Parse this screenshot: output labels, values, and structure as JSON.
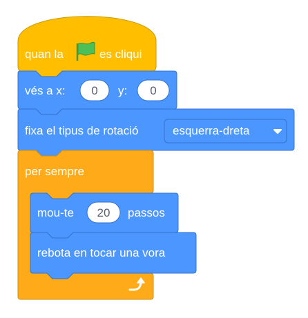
{
  "colors": {
    "events": "#ffbf00",
    "events_stroke": "#cc9900",
    "motion": "#4c97ff",
    "motion_stroke": "#3373cc",
    "control": "#ffab19",
    "control_stroke": "#cf8b17",
    "flag_green": "#4cbf56",
    "input_bg": "#ffffff",
    "input_text": "#575e75"
  },
  "script": {
    "hat": {
      "label_before": "quan la",
      "icon": "green-flag-icon",
      "label_after": "es cliqui"
    },
    "goto": {
      "label_x": "vés a x:",
      "x_value": "0",
      "label_y": "y:",
      "y_value": "0"
    },
    "rotation": {
      "label": "fixa el tipus de rotació",
      "dropdown_value": "esquerra-dreta",
      "dropdown_icon": "caret-down-icon"
    },
    "forever": {
      "label": "per sempre",
      "loop_icon": "loop-arrow-icon"
    },
    "move": {
      "label_before": "mou-te",
      "steps_value": "20",
      "label_after": "passos"
    },
    "bounce": {
      "label": "rebota en tocar una vora"
    }
  }
}
